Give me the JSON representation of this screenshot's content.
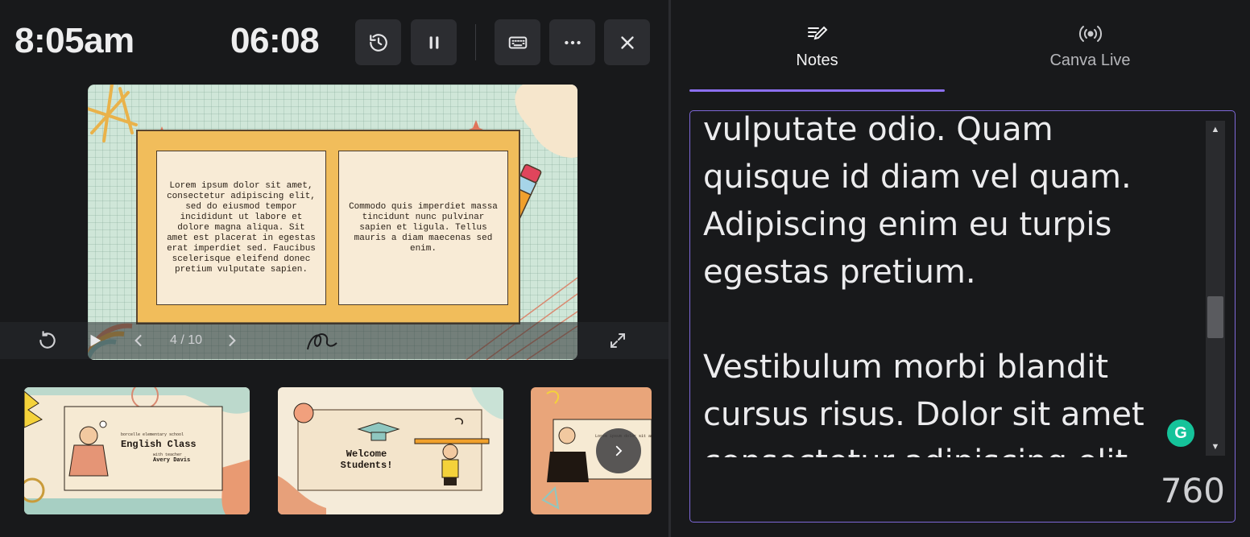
{
  "header": {
    "clock": "8:05am",
    "timer": "06:08",
    "toolbar": [
      {
        "name": "history-button",
        "icon": "history-icon"
      },
      {
        "name": "pause-button",
        "icon": "pause-icon"
      },
      {
        "name": "keyboard-shortcuts-button",
        "icon": "keyboard-icon"
      },
      {
        "name": "more-options-button",
        "icon": "ellipsis-icon"
      },
      {
        "name": "close-button",
        "icon": "close-icon"
      }
    ]
  },
  "slide": {
    "text_left": "Lorem ipsum dolor sit amet, consectetur adipiscing elit, sed do eiusmod tempor incididunt ut labore et dolore magna aliqua. Sit amet est placerat in egestas erat imperdiet sed. Faucibus scelerisque eleifend donec pretium vulputate sapien.",
    "text_right": "Commodo quis imperdiet massa tincidunt nunc pulvinar sapien et ligula. Tellus mauris a diam maecenas sed enim."
  },
  "controls": {
    "page_indicator": "4 / 10"
  },
  "thumbnails": [
    {
      "school": "borcelle elementary school",
      "title": "English Class",
      "with": "with teacher",
      "teacher": "Avery Davis"
    },
    {
      "title_line1": "Welcome",
      "title_line2": "Students!"
    },
    {
      "partial_text": "Lorem ipsum dolor sit amet"
    }
  ],
  "tabs": [
    {
      "label": "Notes",
      "icon": "notes-edit-icon",
      "active": true
    },
    {
      "label": "Canva Live",
      "icon": "broadcast-icon",
      "active": false
    }
  ],
  "notes": {
    "text": "vulputate odio. Quam\nquisque id diam vel quam.\nAdipiscing enim eu turpis\negestas pretium.\n\nVestibulum morbi blandit\ncursus risus. Dolor sit amet\nconsectetur adipiscing elit",
    "char_count": "760"
  },
  "colors": {
    "accent": "#8b6ff0",
    "background": "#18191b",
    "button": "#2c2d31",
    "grammarly": "#15c39a"
  }
}
